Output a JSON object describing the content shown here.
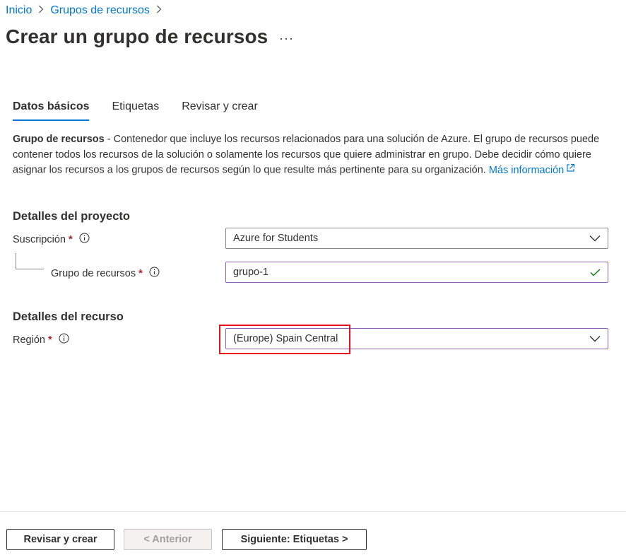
{
  "breadcrumb": {
    "items": [
      "Inicio",
      "Grupos de recursos"
    ],
    "separator": ">"
  },
  "page": {
    "title": "Crear un grupo de recursos",
    "more": "···"
  },
  "tabs": [
    {
      "label": "Datos básicos",
      "active": true
    },
    {
      "label": "Etiquetas",
      "active": false
    },
    {
      "label": "Revisar y crear",
      "active": false
    }
  ],
  "description": {
    "bold": "Grupo de recursos",
    "text": " - Contenedor que incluye los recursos relacionados para una solución de Azure. El grupo de recursos puede contener todos los recursos de la solución o solamente los recursos que quiere administrar en grupo. Debe decidir cómo quiere asignar los recursos a los grupos de recursos según lo que resulte más pertinente para su organización. ",
    "link": "Más información"
  },
  "project_details": {
    "heading": "Detalles del proyecto",
    "subscription": {
      "label": "Suscripción",
      "required": "*",
      "value": "Azure for Students"
    },
    "resource_group": {
      "label": "Grupo de recursos",
      "required": "*",
      "value": "grupo-1"
    }
  },
  "resource_details": {
    "heading": "Detalles del recurso",
    "region": {
      "label": "Región",
      "required": "*",
      "value": "(Europe) Spain Central"
    }
  },
  "footer": {
    "review_create": "Revisar y crear",
    "previous": "< Anterior",
    "next": "Siguiente: Etiquetas >"
  },
  "colors": {
    "accent": "#0078d4",
    "required": "#a4262c",
    "valid": "#107c10",
    "focus_border": "#8764b8",
    "highlight": "#e81123"
  }
}
